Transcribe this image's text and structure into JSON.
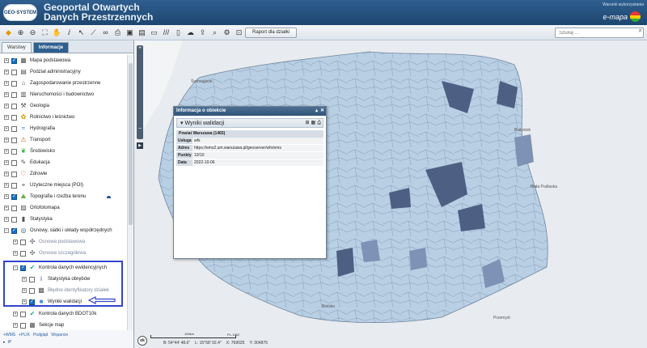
{
  "header": {
    "logo_text": "GEO-SYSTEM",
    "title_line1": "Geoportal Otwartych",
    "title_line2": "Danych Przestrzennych",
    "terms_link": "Warunki wykorzystania",
    "brand": "e-mapa"
  },
  "toolbar": {
    "report_button": "Raport dla działki",
    "search_placeholder": "Szukaj ..."
  },
  "tabs": [
    {
      "label": "Warstwy",
      "active": false
    },
    {
      "label": "Informacje",
      "active": true
    }
  ],
  "tree": [
    {
      "label": "Mapa podstawowa",
      "checked": true,
      "icon": "map-icon"
    },
    {
      "label": "Podział administracyjny",
      "checked": false,
      "icon": "admin-map-icon"
    },
    {
      "label": "Zagospodarowanie przestrzenne",
      "checked": false,
      "icon": "planning-icon"
    },
    {
      "label": "Nieruchomości i budownictwo",
      "checked": false,
      "icon": "buildings-icon"
    },
    {
      "label": "Geologia",
      "checked": false,
      "icon": "pickaxe-icon"
    },
    {
      "label": "Rolnictwo i leśnictwo",
      "checked": false,
      "icon": "wheat-icon"
    },
    {
      "label": "Hydrografia",
      "checked": false,
      "icon": "water-icon"
    },
    {
      "label": "Transport",
      "checked": false,
      "icon": "traffic-sign-icon"
    },
    {
      "label": "Środowisko",
      "checked": false,
      "icon": "leaf-icon"
    },
    {
      "label": "Edukacja",
      "checked": false,
      "icon": "education-icon"
    },
    {
      "label": "Zdrowie",
      "checked": false,
      "icon": "heart-icon"
    },
    {
      "label": "Użyteczne miejsca (POI)",
      "checked": false,
      "icon": "poi-icon"
    },
    {
      "label": "Topografia i rzeźba terenu",
      "checked": true,
      "icon": "topography-icon"
    },
    {
      "label": "Ortofotomapa",
      "checked": false,
      "icon": "orthophoto-icon"
    },
    {
      "label": "Statystyka",
      "checked": false,
      "icon": "statistics-icon"
    },
    {
      "label": "Osnowy, siatki i układy współrzędnych",
      "checked": true,
      "icon": "globe-icon"
    },
    {
      "label": "Osnowa podstawowa",
      "checked": false,
      "icon": "network-icon"
    },
    {
      "label": "Osnowa szczegółowa",
      "checked": false,
      "icon": "network-icon"
    },
    {
      "label": "Kontrola danych ewidencyjnych",
      "checked": true,
      "icon": "check-icon"
    },
    {
      "label": "Statystyka obrębów",
      "checked": false,
      "icon": "info-icon"
    },
    {
      "label": "Błędne identyfikatory działek",
      "checked": false,
      "icon": "parcel-error-icon"
    },
    {
      "label": "Wyniki walidacji",
      "checked": true,
      "icon": "validation-icon"
    },
    {
      "label": "Kontrola danych BDOT10k",
      "checked": false,
      "icon": "check-icon"
    },
    {
      "label": "Sekcje map",
      "checked": false,
      "icon": "grid-icon"
    }
  ],
  "footer": {
    "links": [
      "+WMS",
      "+PLIK",
      "Podgląd",
      "Wsparcie"
    ],
    "ip_label": "IP"
  },
  "popup": {
    "title": "Informacja o obiekcie",
    "section": "Wyniki walidacji",
    "feature_name": "Powiat Warszawa (1465)",
    "rows": [
      {
        "key": "Usługa",
        "value": "wfs"
      },
      {
        "key": "Adres",
        "value": "https://ems2.um.warszawa.pl/geoserver/wfs/ems"
      },
      {
        "key": "Punkty",
        "value": "10/10"
      },
      {
        "key": "Data",
        "value": "2022-10-06"
      }
    ]
  },
  "map": {
    "cities": [
      "Świnoujście",
      "Białystok",
      "Biała Podlaska",
      "Bielsko",
      "Przemyśl"
    ]
  },
  "status": {
    "ok_label": "ok",
    "scale_label": "100km",
    "scale_denominator": "PL-1992",
    "lat": "B: 54°44' 48.6\"",
    "lon": "L: 15°58' 02.4\"",
    "x": "X: 769025",
    "y": "Y: 304875"
  }
}
